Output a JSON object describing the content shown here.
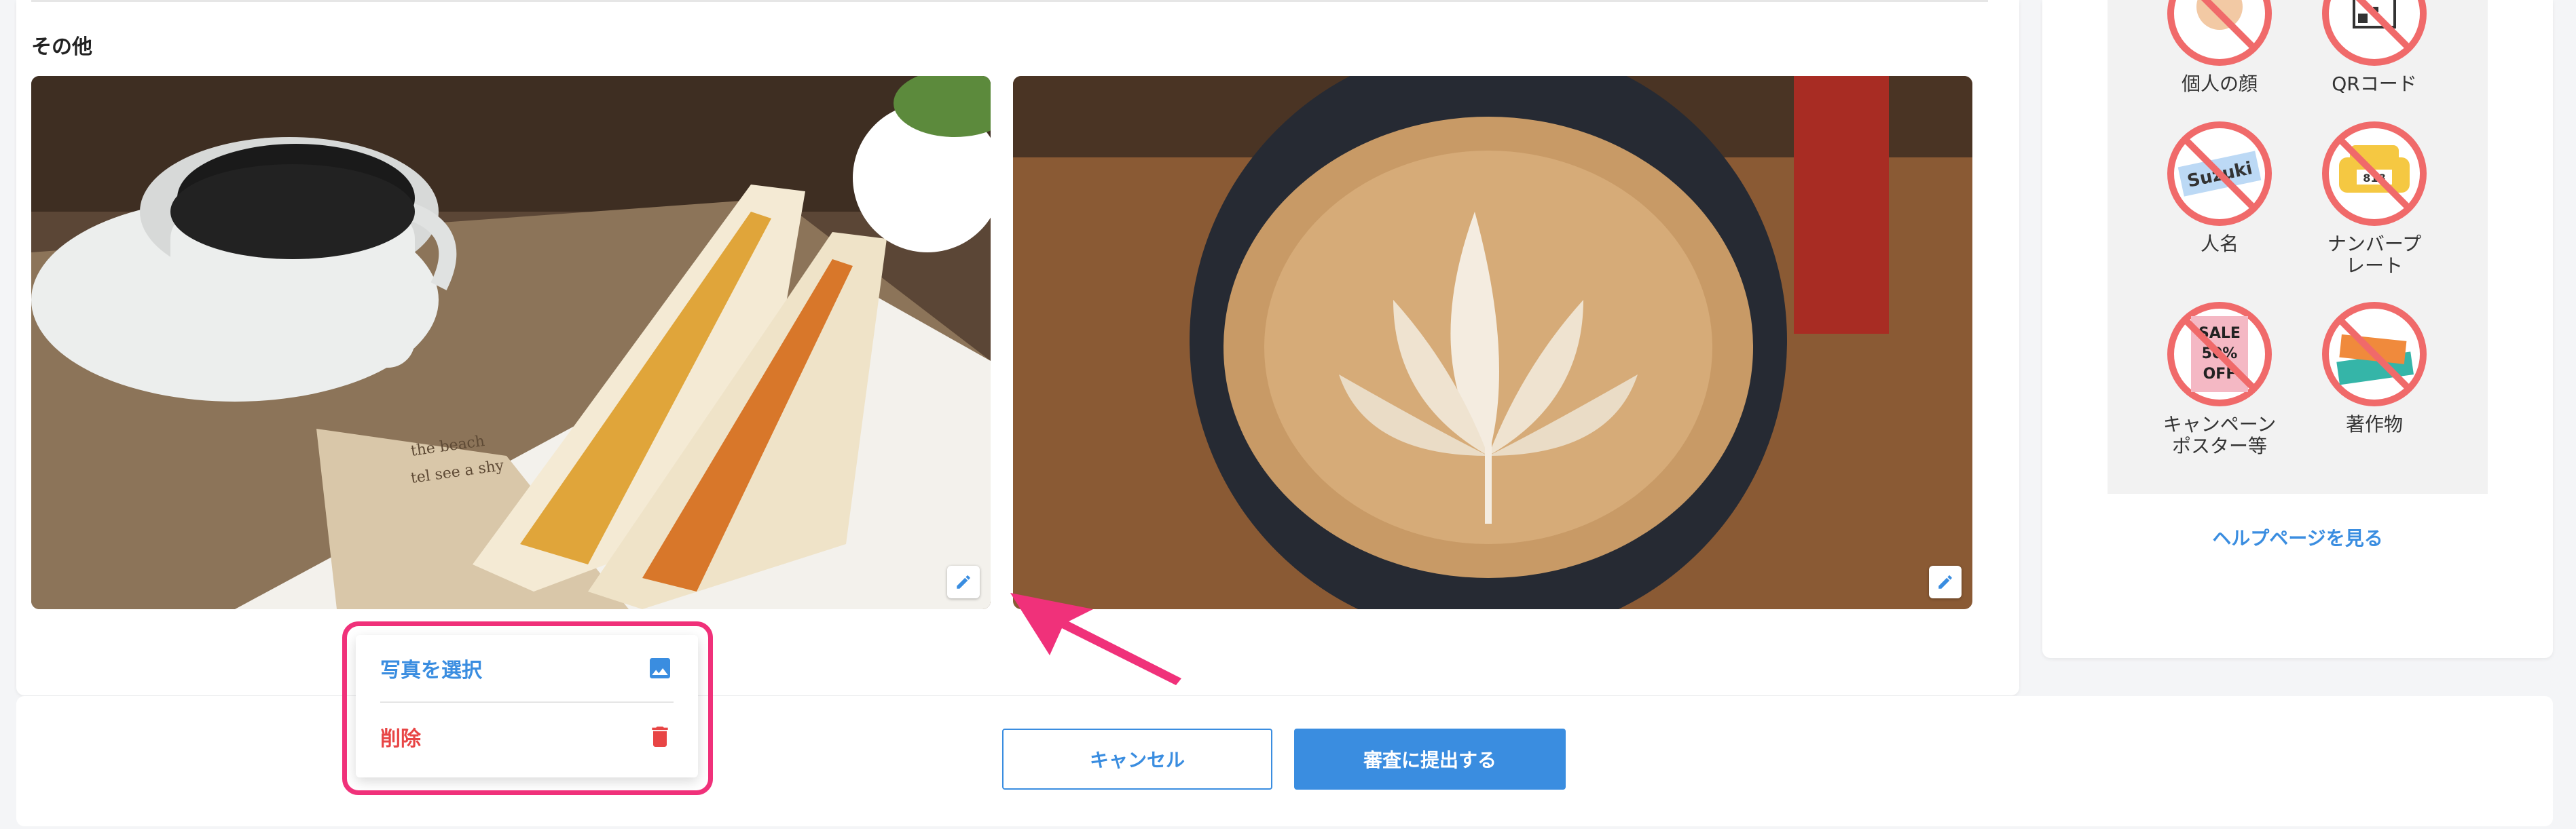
{
  "section": {
    "title": "その他"
  },
  "photos": [
    {
      "alt": "egg-sandwich-and-coffee",
      "edit_icon": "pencil-icon"
    },
    {
      "alt": "latte-art",
      "edit_icon": "pencil-icon"
    }
  ],
  "ng_examples": [
    {
      "label": "個人の顔",
      "icon": "face-prohibited-icon"
    },
    {
      "label": "QRコード",
      "icon": "qr-prohibited-icon"
    },
    {
      "label": "人名",
      "icon": "name-prohibited-icon",
      "icon_text": "Suzuki"
    },
    {
      "label": "ナンバープレート",
      "icon": "license-plate-prohibited-icon",
      "icon_text": "818"
    },
    {
      "label": "キャンペーンポスター等",
      "icon": "poster-prohibited-icon",
      "icon_text": "SALE 50% OFF"
    },
    {
      "label": "著作物",
      "icon": "copyright-book-prohibited-icon"
    }
  ],
  "help_link": "ヘルプページを見る",
  "buttons": {
    "cancel": "キャンセル",
    "submit": "審査に提出する"
  },
  "menu": {
    "select_photo": "写真を選択",
    "delete": "削除"
  },
  "colors": {
    "accent": "#3a8de0",
    "danger": "#e84545",
    "highlight": "#f0317a",
    "prohibit": "#f06a6a"
  }
}
